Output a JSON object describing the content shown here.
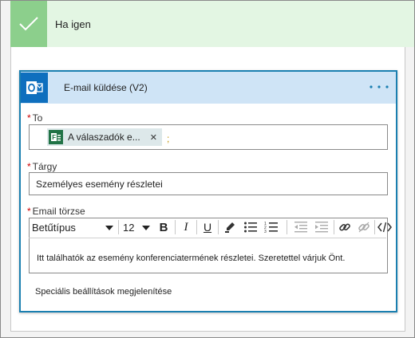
{
  "condition": {
    "title": "Ha igen"
  },
  "action": {
    "title": "E-mail küldése (V2)",
    "fields": {
      "to": {
        "label": "To",
        "token": "A válaszadók e...",
        "separator": ";"
      },
      "subject": {
        "label": "Tárgy",
        "value": "Személyes esemény részletei"
      },
      "body": {
        "label": "Email törzse",
        "font": "Betűtípus",
        "size": "12",
        "text": "Itt találhatók az esemény konferenciatermének részletei. Szeretettel várjuk Önt."
      }
    },
    "advanced": "Speciális beállítások megjelenítése"
  },
  "colors": {
    "condition_header": "#e3f6e3",
    "condition_check": "#8ccf8c",
    "card_header": "#cfe4f6",
    "card_border": "#1a7fb0",
    "outlook_blue": "#0e6fbe",
    "token_bg": "#dde8ea",
    "forms_green": "#217346",
    "required_red": "#c00000"
  },
  "icons": [
    "check-icon",
    "outlook-icon",
    "more-icon",
    "forms-icon",
    "close-icon",
    "bold-icon",
    "italic-icon",
    "underline-icon",
    "highlight-icon",
    "bullet-list-icon",
    "numbered-list-icon",
    "decrease-indent-icon",
    "increase-indent-icon",
    "link-icon",
    "unlink-icon",
    "code-icon",
    "chevron-down-icon"
  ]
}
